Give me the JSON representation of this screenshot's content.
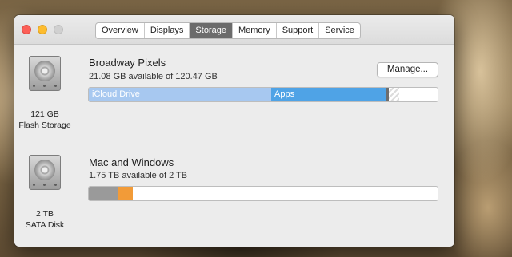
{
  "tabs": [
    {
      "label": "Overview",
      "active": false
    },
    {
      "label": "Displays",
      "active": false
    },
    {
      "label": "Storage",
      "active": true
    },
    {
      "label": "Memory",
      "active": false
    },
    {
      "label": "Support",
      "active": false
    },
    {
      "label": "Service",
      "active": false
    }
  ],
  "drives": [
    {
      "size": "121 GB",
      "type": "Flash Storage",
      "volume_name": "Broadway Pixels",
      "availability": "21.08 GB available of 120.47 GB",
      "manage_label": "Manage...",
      "segments": [
        {
          "label": "iCloud Drive",
          "fraction": 0.524,
          "color": "#a7c8f0"
        },
        {
          "label": "Apps",
          "fraction": 0.33,
          "color": "#4fa3e6"
        },
        {
          "label": "",
          "fraction": 0.008,
          "color": "#6d6d6d"
        },
        {
          "label": "",
          "fraction": 0.03,
          "color": "purgeable-stripes"
        }
      ]
    },
    {
      "size": "2 TB",
      "type": "SATA Disk",
      "volume_name": "Mac and Windows",
      "availability": "1.75 TB available of 2 TB",
      "segments": [
        {
          "label": "",
          "fraction": 0.082,
          "color": "#9a9a9a"
        },
        {
          "label": "",
          "fraction": 0.044,
          "color": "#f29b38"
        }
      ]
    }
  ]
}
